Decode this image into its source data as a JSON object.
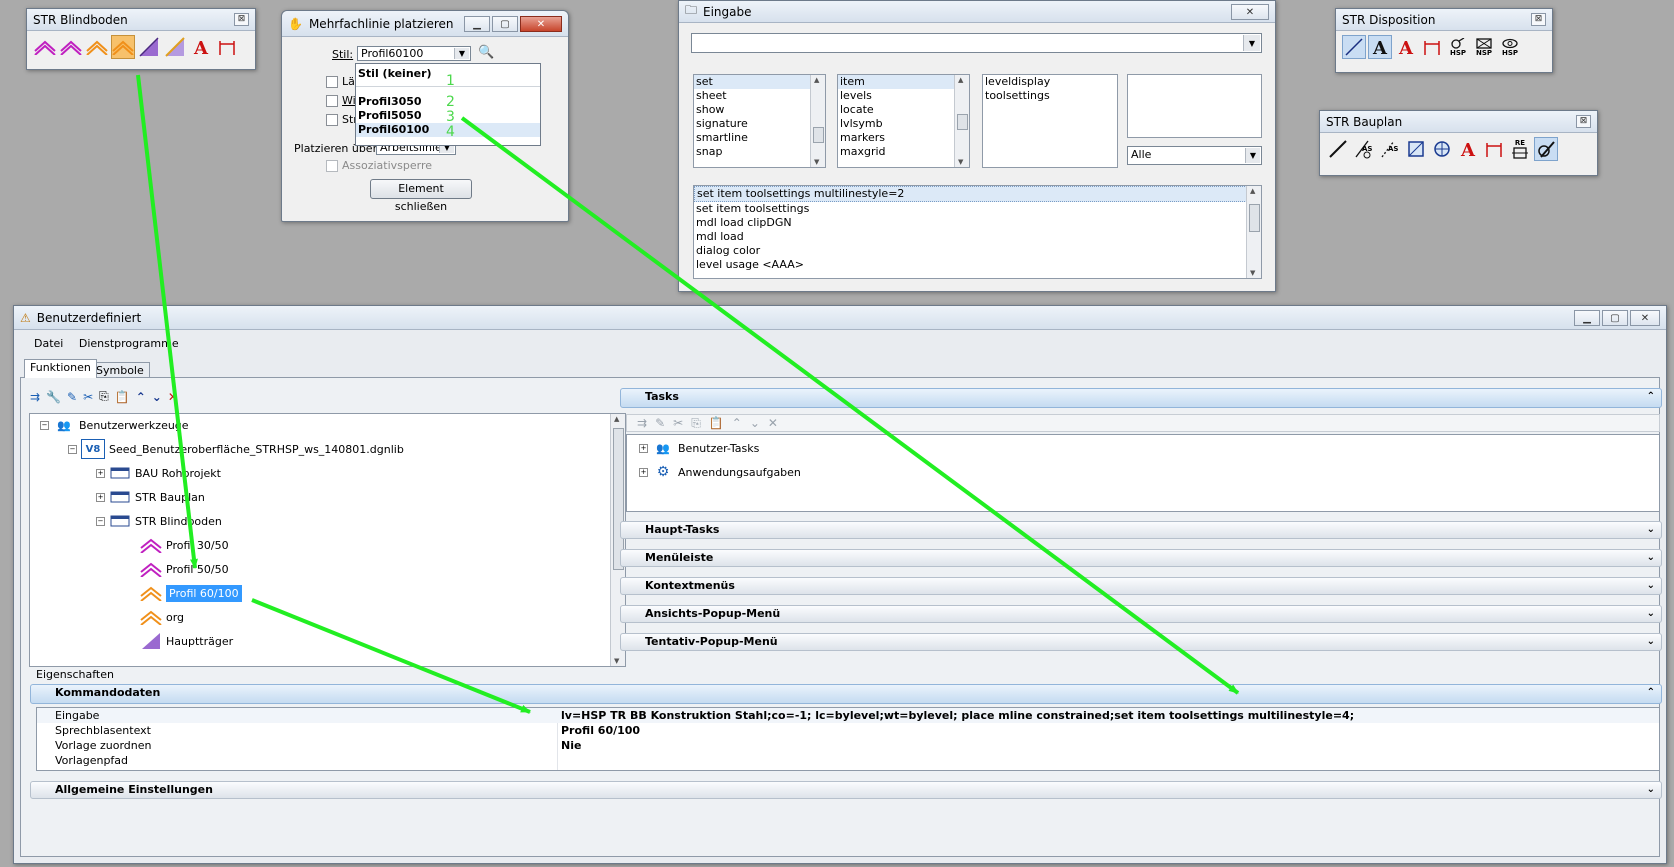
{
  "colors": {
    "arrow": "#22ee22",
    "selection": "#3399ff",
    "accent_orange": "#f7c16b"
  },
  "blindboden": {
    "title": "STR Blindboden",
    "close": "⊠"
  },
  "disposition": {
    "title": "STR Disposition",
    "close": "⊠",
    "labels": [
      "HSP",
      "NSP",
      "HSP"
    ]
  },
  "bauplan": {
    "title": "STR Bauplan",
    "close": "⊠",
    "re_label": "RE"
  },
  "mline": {
    "title": "Mehrfachlinie platzieren",
    "stil_label": "Stil:",
    "stil_value": "Profil60100",
    "check_laen": "Län",
    "check_wi": "Wi",
    "check_str": "Str",
    "platzieren_label": "Platzieren über:",
    "platzieren_value": "Arbeitslinie",
    "assoz": "Assoziativsperre",
    "close_button": "Element schließen",
    "options": [
      "Stil (keiner)",
      "Profil3050",
      "Profil5050",
      "Profil60100"
    ],
    "numbers": [
      "1",
      "2",
      "3",
      "4"
    ]
  },
  "eingabe": {
    "title": "Eingabe",
    "input_value": "",
    "list1": [
      "set",
      "sheet",
      "show",
      "signature",
      "smartline",
      "snap"
    ],
    "list2": [
      "item",
      "levels",
      "locate",
      "lvlsymb",
      "markers",
      "maxgrid"
    ],
    "list3": [
      "leveldisplay",
      "toolsettings"
    ],
    "filter_value": "Alle",
    "history": [
      "set item toolsettings multilinestyle=2",
      "set item toolsettings",
      "mdl load clipDGN",
      "mdl load",
      "dialog color",
      "level usage <AAA>"
    ]
  },
  "main": {
    "title": "Benutzerdefiniert",
    "menu": [
      "Datei",
      "Dienstprogramme"
    ],
    "tabs": [
      "Funktionen",
      "Symbole"
    ],
    "tree": {
      "root": "Benutzerwerkzeuge",
      "lib": "Seed_Benutzeroberfläche_STRHSP_ws_140801.dgnlib",
      "groups": [
        "BAU Rohprojekt",
        "STR Bauplan",
        "STR Blindboden"
      ],
      "items": [
        "Profil 30/50",
        "Profil 50/50",
        "Profil 60/100",
        "org",
        "Hauptträger"
      ]
    },
    "tasks": {
      "header": "Tasks",
      "items": [
        "Benutzer-Tasks",
        "Anwendungsaufgaben"
      ],
      "panels": [
        "Haupt-Tasks",
        "Menüleiste",
        "Kontextmenüs",
        "Ansichts-Popup-Menü",
        "Tentativ-Popup-Menü"
      ]
    },
    "properties": {
      "label": "Eigenschaften",
      "header": "Kommandodaten",
      "rows": [
        {
          "key": "Eingabe",
          "value": "lv=HSP TR BB Konstruktion Stahl;co=-1; lc=bylevel;wt=bylevel; place mline constrained;set item toolsettings multilinestyle=4;"
        },
        {
          "key": "Sprechblasentext",
          "value": "Profil 60/100"
        },
        {
          "key": "Vorlage zuordnen",
          "value": "Nie"
        },
        {
          "key": "Vorlagenpfad",
          "value": ""
        }
      ],
      "general": "Allgemeine Einstellungen"
    }
  }
}
